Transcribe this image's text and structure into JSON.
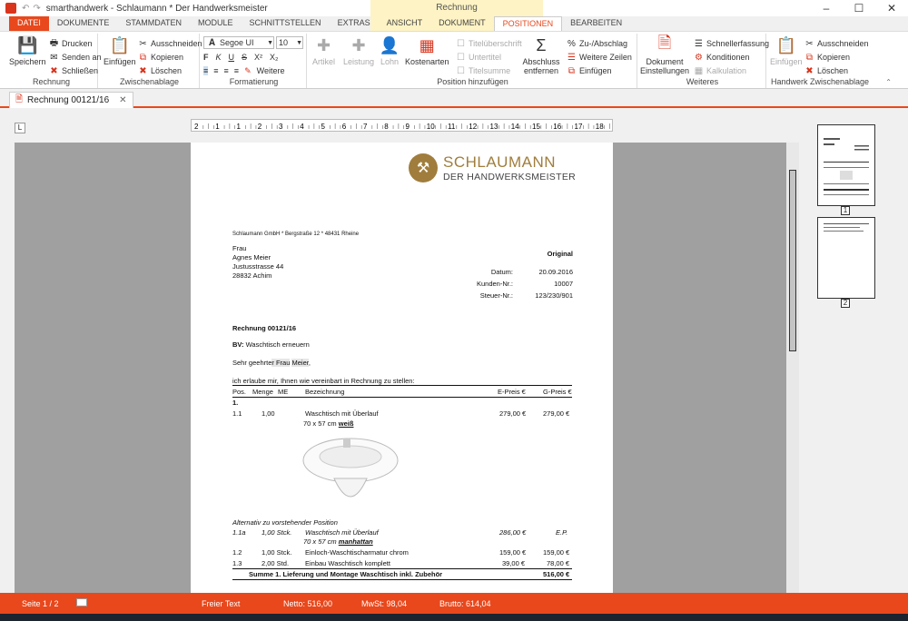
{
  "window": {
    "title": "smarthandwerk - Schlaumann * Der Handwerksmeister",
    "context_group": "Rechnung",
    "controls": [
      "–",
      "☐",
      "✕"
    ]
  },
  "tabs": [
    "DATEI",
    "DOKUMENTE",
    "STAMMDATEN",
    "MODULE",
    "SCHNITTSTELLEN",
    "EXTRAS",
    "ANSICHT",
    "DOKUMENT",
    "POSITIONEN",
    "BEARBEITEN"
  ],
  "ribbon": {
    "rechnung": {
      "label": "Rechnung",
      "save": "Speichern",
      "print": "Drucken",
      "send": "Senden an",
      "close": "Schließen"
    },
    "clipboard": {
      "label": "Zwischenablage",
      "paste": "Einfügen",
      "cut": "Ausschneiden",
      "copy": "Kopieren",
      "delete": "Löschen"
    },
    "format": {
      "label": "Formatierung",
      "font": "Segoe UI",
      "size": "10",
      "more": "Weitere"
    },
    "position": {
      "label": "Position hinzufügen",
      "article": "Artikel",
      "service": "Leistung",
      "wage": "Lohn",
      "cost": "Kostenarten",
      "title_head": "Titelüberschrift",
      "subtitle": "Untertitel",
      "title_sum": "Titelsumme",
      "close_sum": "Abschluss entfernen",
      "addsub": "Zu-/Abschlag",
      "more_lines": "Weitere Zeilen",
      "insert": "Einfügen"
    },
    "more": {
      "label": "Weiteres",
      "doc_settings": "Dokument Einstellungen",
      "quick": "Schnellerfassung",
      "conditions": "Konditionen",
      "calc": "Kalkulation"
    },
    "hw_clip": {
      "label": "Handwerk Zwischenablage",
      "paste": "Einfügen",
      "cut": "Ausschneiden",
      "copy": "Kopieren",
      "delete": "Löschen"
    }
  },
  "doctab": "Rechnung 00121/16",
  "ruler_numbers": [
    "2",
    "1",
    "1",
    "2",
    "3",
    "4",
    "5",
    "6",
    "7",
    "8",
    "9",
    "10",
    "11",
    "12",
    "13",
    "14",
    "15",
    "16",
    "17",
    "18"
  ],
  "page": {
    "logo_line1": "SCHLAUMANN",
    "logo_line2": "DER HANDWERKSMEISTER",
    "sender": "Schlaumann GmbH * Bergstraße 12 * 48431 Rheine",
    "addr": [
      "Frau",
      "Agnes Meier",
      "Justusstrasse 44",
      "28832 Achim"
    ],
    "original": "Original",
    "meta": [
      {
        "k": "Datum:",
        "v": "20.09.2016"
      },
      {
        "k": "Kunden-Nr.:",
        "v": "10007"
      },
      {
        "k": "Steuer-Nr.:",
        "v": "123/230/901"
      }
    ],
    "heading": "Rechnung 00121/16",
    "bv_label": "BV:",
    "bv": "Waschtisch erneuern",
    "salutation_a": "Sehr geehrte",
    "salutation_b": "r Frau",
    "salutation_c": "Meier",
    "salutation_d": ",",
    "intro": "ich erlaube mir, Ihnen wie vereinbart in Rechnung zu stellen:",
    "cols": [
      "Pos.",
      "Menge",
      "ME",
      "Bezeichnung",
      "E-Preis €",
      "G-Preis €"
    ],
    "group1": "1.",
    "item11": {
      "pos": "1.1",
      "qty": "1,00",
      "desc": "Waschtisch mit Überlauf",
      "desc2": "70 x 57 cm",
      "desc2b": "weiß",
      "ep": "279,00 €",
      "gp": "279,00 €"
    },
    "alt_label": "Alternativ zu vorstehender Position",
    "item1a": {
      "pos": "1.1a",
      "qty": "1,00 Stck.",
      "desc": "Waschtisch mit Überlauf",
      "desc2": "70 x 57 cm",
      "desc2b": "manhattan",
      "ep": "286,00 €",
      "gp": "E.P."
    },
    "item12": {
      "pos": "1.2",
      "qty": "1,00 Stck.",
      "desc": "Einloch-Waschtischarmatur chrom",
      "ep": "159,00 €",
      "gp": "159,00 €"
    },
    "item13": {
      "pos": "1.3",
      "qty": "2,00 Std.",
      "desc": "Einbau Waschtisch komplett",
      "ep": "39,00 €",
      "gp": "78,00 €"
    },
    "sum_label": "Summe 1. Lieferung und Montage Waschtisch inkl. Zubehör",
    "sum": "516,00 €"
  },
  "thumbs": [
    "1",
    "2"
  ],
  "status": {
    "page": "Seite 1 / 2",
    "text": "Freier Text",
    "net": "Netto: 516,00",
    "vat": "MwSt: 98,04",
    "gross": "Brutto: 614,04"
  },
  "colors": {
    "accent": "#e8481c",
    "logo": "#a07d3c"
  }
}
